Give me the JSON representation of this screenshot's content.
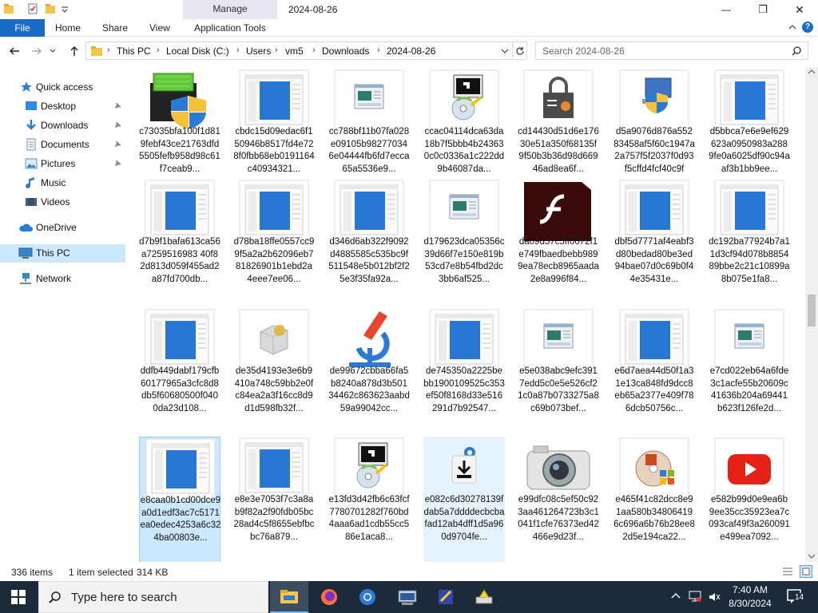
{
  "window": {
    "title": "2024-08-26",
    "manage_tab": "Manage",
    "controls": {
      "minimize": "—",
      "maximize": "❐",
      "close": "✕"
    }
  },
  "ribbon": {
    "file": "File",
    "tabs": [
      "Home",
      "Share",
      "View",
      "Application Tools"
    ]
  },
  "navigation": {
    "breadcrumb": [
      "This PC",
      "Local Disk (C:)",
      "Users",
      "vm5",
      "Downloads",
      "2024-08-26"
    ],
    "search_placeholder": "Search 2024-08-26"
  },
  "sidebar": {
    "quick_access": "Quick access",
    "items": [
      {
        "label": "Desktop",
        "icon": "desktop-icon",
        "pinned": true
      },
      {
        "label": "Downloads",
        "icon": "downloads-icon",
        "pinned": true
      },
      {
        "label": "Documents",
        "icon": "documents-icon",
        "pinned": true
      },
      {
        "label": "Pictures",
        "icon": "pictures-icon",
        "pinned": true
      },
      {
        "label": "Music",
        "icon": "music-icon",
        "pinned": false
      },
      {
        "label": "Videos",
        "icon": "videos-icon",
        "pinned": false
      }
    ],
    "onedrive": "OneDrive",
    "this_pc": "This PC",
    "network": "Network"
  },
  "files": [
    {
      "name": "c73035bfa100f1d819febf43ce21763dfd5505fefb958d98c61f7ceab9...",
      "icon": "installer-shield-icon"
    },
    {
      "name": "cbdc15d09edac6f150946b8517fd4e728f0fbb68eb0191164c40934321...",
      "icon": "blue-window-icon"
    },
    {
      "name": "cc788bf11b07fa028e09105b982770346e04444fb6fd7ecca65a5536e9...",
      "icon": "app-window-icon"
    },
    {
      "name": "ccac04114dca63da18b7f5bbb4b243630c0c0336a1c222dd9b46087da...",
      "icon": "setup-disc-icon"
    },
    {
      "name": "cd14430d51d6e17630e51a350f68135f9f50b3b36d98d66946ad8ea6f...",
      "icon": "certificate-lock-icon"
    },
    {
      "name": "d5a9076d876a55283458af5f60c1947a2a757f5f2037f0d93f5cffd4fcf40c9f",
      "icon": "shield-computer-icon"
    },
    {
      "name": "d5bbca7e6e9ef629623a0950983a2889fe0a6025df90c94aaf3b1bb9ee...",
      "icon": "blue-window-icon"
    },
    {
      "name": "d7b9f1bafa613ca56a7259516983 40f82d813d059f455ad2a87fd700db...",
      "icon": "blue-window-icon"
    },
    {
      "name": "d78ba18ffe0557cc99f5a2a2b62096eb781826901b1ebd2a4eee7ee06...",
      "icon": "blue-window-icon"
    },
    {
      "name": "d346d6ab322f9092d4885585c535bc9f511548e5b012bf2f25e3f35fa92a...",
      "icon": "blue-window-icon"
    },
    {
      "name": "d179623dca05356c39d66f7e150e819b53cd7e8b54fbd2dc3bb6af525...",
      "icon": "app-window-icon"
    },
    {
      "name": "da09d57c5ff0072f1e749fbaedbebb9899ea78ecb8965aada2e8a996f84...",
      "icon": "flash-icon"
    },
    {
      "name": "dbf5d7771af4eabf3d80bedad80be3ed94bae07d0c69b0f44e35431e...",
      "icon": "blue-window-icon"
    },
    {
      "name": "dc192ba77924b7a11d3cf94d078b885489bbe2c21c10899a8b075e1fa8...",
      "icon": "blue-window-icon"
    },
    {
      "name": "ddfb449dabf179cfb60177965a3cfc8d8db5f60680500f0400da23d108...",
      "icon": "blue-window-icon"
    },
    {
      "name": "de35d4193e3e6b9410a748c59bb2e0fc84ea2a3f16cc8d9d1d598fb32f...",
      "icon": "package-box-icon"
    },
    {
      "name": "de99672cbba66fa5b8240a878d3b50134462c863623aabd59a99042cc...",
      "icon": "microscope-icon"
    },
    {
      "name": "de745350a2225bebb1900109525c353ef50f8168d33e516291d7b92547...",
      "icon": "blue-window-icon"
    },
    {
      "name": "e5e038abc9efc3917edd5c0e5e526cf21c0a87b0733275a8c69b073bef...",
      "icon": "app-window-icon"
    },
    {
      "name": "e6d7aea44d50f1a31e13ca848fd9dcc8eb65a2377e409f786dcb50756c...",
      "icon": "blue-window-icon"
    },
    {
      "name": "e7cd022eb64a6fde3c1acfe55b20609c41636b204a69441b623f126fe2d...",
      "icon": "app-window-icon"
    },
    {
      "name": "e8caa0b1cd00dce9a0d1edf3ac7c5171ea0edec4253a6c324ba00803e...",
      "icon": "blue-window-icon",
      "selected": true
    },
    {
      "name": "e8e3e7053f7c3a8ab9f82a2f90fdb05bc28ad4c5f8655ebfbcbc76a879...",
      "icon": "blue-window-icon"
    },
    {
      "name": "e13fd3d42fb6c63fcf7780701282f760bd4aaa6ad1cdb55cc586e1aca8...",
      "icon": "setup-disc-icon"
    },
    {
      "name": "e082c6d30278139fdab5a7ddddecbcbafad12ab4dff1d5a960d9704fe...",
      "icon": "download-installer-icon",
      "hovered": true
    },
    {
      "name": "e99dfc08c5ef50c923aa461264723b3c1041f1cfe76373ed42466e9d23f...",
      "icon": "camera-icon"
    },
    {
      "name": "e465f41c82dcc8e91aa580b348064196c696a6b76b28ee82d5e194ca22...",
      "icon": "office-disc-icon"
    },
    {
      "name": "e582b99d0e9ea6b9ee35cc35923ea7c093caf49f3a260091e499ea7092...",
      "icon": "youtube-icon"
    }
  ],
  "status": {
    "item_count": "336 items",
    "selection": "1 item selected",
    "size": "314 KB"
  },
  "taskbar": {
    "search_placeholder": "Type here to search",
    "time": "7:40 AM",
    "date": "8/30/2024",
    "notifications": "14"
  }
}
